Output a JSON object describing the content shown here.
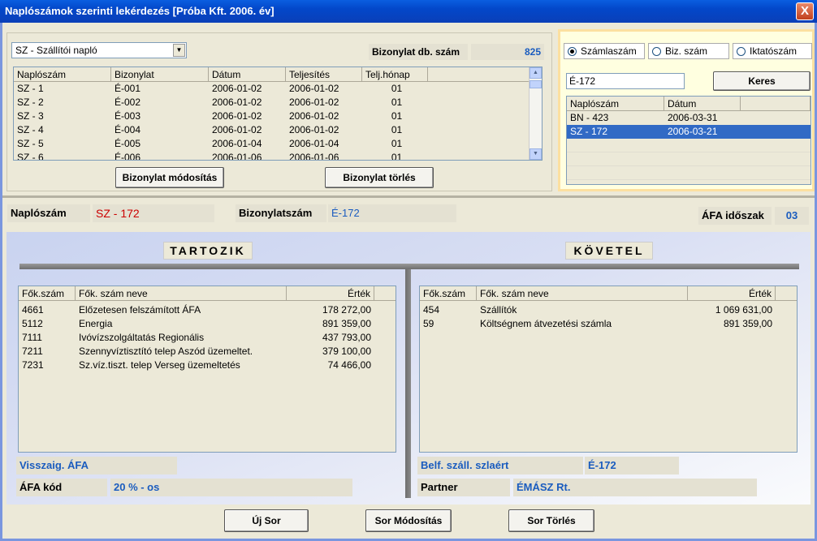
{
  "window": {
    "title": "Naplószámok szerinti lekérdezés   [Próba Kft.   2006. év]",
    "close": "X"
  },
  "top": {
    "journal_select": "SZ - Szállítói napló",
    "doc_count_label": "Bizonylat db. szám",
    "doc_count_value": "825",
    "columns": [
      "Naplószám",
      "Bizonylat",
      "Dátum",
      "Teljesítés",
      "Telj.hónap"
    ],
    "rows": [
      [
        "SZ - 1",
        "É-001",
        "2006-01-02",
        "2006-01-02",
        "01"
      ],
      [
        "SZ - 2",
        "É-002",
        "2006-01-02",
        "2006-01-02",
        "01"
      ],
      [
        "SZ - 3",
        "É-003",
        "2006-01-02",
        "2006-01-02",
        "01"
      ],
      [
        "SZ - 4",
        "É-004",
        "2006-01-02",
        "2006-01-02",
        "01"
      ],
      [
        "SZ - 5",
        "É-005",
        "2006-01-04",
        "2006-01-04",
        "01"
      ],
      [
        "SZ - 6",
        "É-006",
        "2006-01-06",
        "2006-01-06",
        "01"
      ]
    ],
    "modify_button": "Bizonylat módosítás",
    "delete_button": "Bizonylat törlés"
  },
  "search": {
    "radio1": "Számlaszám",
    "radio2": "Biz. szám",
    "radio3": "Iktatószám",
    "input_value": "É-172",
    "button": "Keres",
    "columns": [
      "Naplószám",
      "Dátum"
    ],
    "rows": [
      [
        "BN - 423",
        "2006-03-31"
      ],
      [
        "SZ - 172",
        "2006-03-21"
      ]
    ]
  },
  "header": {
    "naploszam_label": "Naplószám",
    "naploszam_value": "SZ - 172",
    "bizonylat_label": "Bizonylatszám",
    "bizonylat_value": "É-172",
    "afa_label": "ÁFA időszak",
    "afa_value": "03"
  },
  "tartozik": {
    "title": "TARTOZIK",
    "columns": [
      "Fők.szám",
      "Fők. szám neve",
      "Érték"
    ],
    "rows": [
      [
        "4661",
        "Előzetesen felszámított ÁFA",
        "178 272,00"
      ],
      [
        "5112",
        "Energia",
        "891 359,00"
      ],
      [
        "7111",
        "Ivóvízszolgáltatás  Regionális",
        "437 793,00"
      ],
      [
        "7211",
        "Szennyvíztisztító telep Aszód üzemeltet.",
        "379 100,00"
      ],
      [
        "7231",
        "Sz.víz.tiszt. telep Verseg üzemeltetés",
        "74 466,00"
      ]
    ],
    "vissz_label": "Visszaig. ÁFA",
    "afa_kod_label": "ÁFA kód",
    "afa_kod_value": "20 % - os"
  },
  "kovetel": {
    "title": "KÖVETEL",
    "columns": [
      "Fők.szám",
      "Fők. szám neve",
      "Érték"
    ],
    "rows": [
      [
        "454",
        "Szállítók",
        "1 069 631,00"
      ],
      [
        "59",
        "Költségnem átvezetési számla",
        "891 359,00"
      ]
    ],
    "belf_label": "Belf. száll. szlaért",
    "belf_value": "É-172",
    "partner_label": "Partner",
    "partner_value": "ÉMÁSZ Rt."
  },
  "bottom": {
    "new_row": "Új Sor",
    "modify_row": "Sor Módosítás",
    "delete_row": "Sor Törlés"
  }
}
